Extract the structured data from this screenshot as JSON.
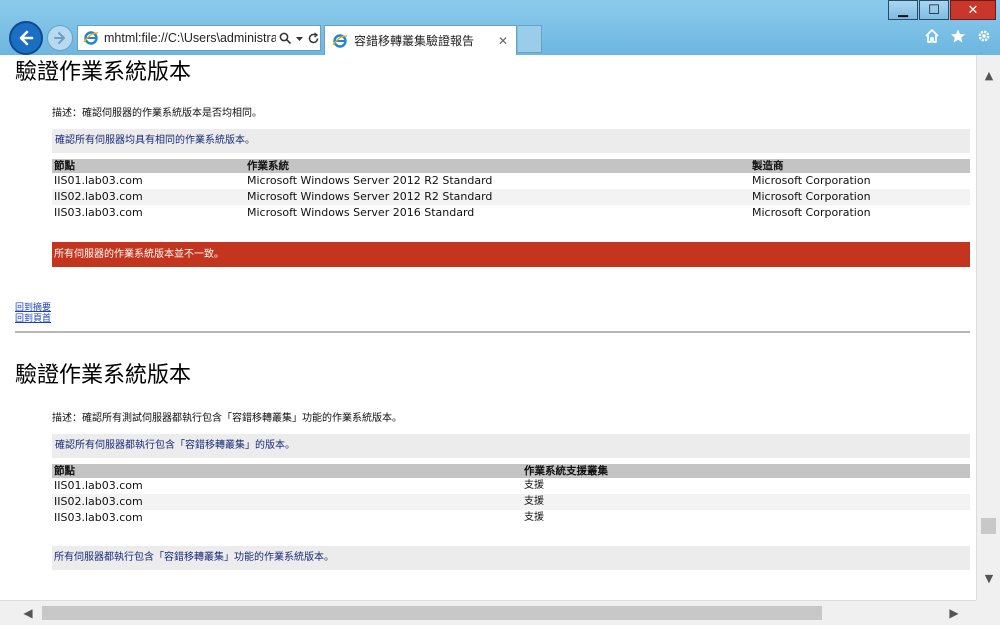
{
  "browser": {
    "address": "mhtml:file://C:\\Users\\administra",
    "tab_title": "容錯移轉叢集驗證報告",
    "tab_close": "✕",
    "window_controls": {
      "minimize": "▁",
      "maximize": "☐",
      "close": "✕"
    },
    "icons": [
      "back-arrow-icon",
      "forward-arrow-icon",
      "ie-logo-icon",
      "search-icon",
      "dropdown-icon",
      "refresh-icon",
      "home-icon",
      "favorites-star-icon",
      "settings-gear-icon"
    ]
  },
  "section1": {
    "title": "驗證作業系統版本",
    "description": "描述：確認伺服器的作業系統版本是否均相同。",
    "info": "確認所有伺服器均具有相同的作業系統版本。",
    "table": {
      "headers": [
        "節點",
        "作業系統",
        "製造商"
      ],
      "rows": [
        [
          "IIS01.lab03.com",
          "Microsoft Windows Server 2012 R2 Standard",
          "Microsoft Corporation"
        ],
        [
          "IIS02.lab03.com",
          "Microsoft Windows Server 2012 R2 Standard",
          "Microsoft Corporation"
        ],
        [
          "IIS03.lab03.com",
          "Microsoft Windows Server 2016 Standard",
          "Microsoft Corporation"
        ]
      ]
    },
    "error": "所有伺服器的作業系統版本並不一致。",
    "links": [
      "回到摘要",
      "回到頁首"
    ]
  },
  "section2": {
    "title": "驗證作業系統版本",
    "description": "描述：確認所有測試伺服器都執行包含「容錯移轉叢集」功能的作業系統版本。",
    "info": "確認所有伺服器都執行包含「容錯移轉叢集」的版本。",
    "table": {
      "headers": [
        "節點",
        "作業系統支援叢集"
      ],
      "rows": [
        [
          "IIS01.lab03.com",
          "支援"
        ],
        [
          "IIS02.lab03.com",
          "支援"
        ],
        [
          "IIS03.lab03.com",
          "支援"
        ]
      ]
    },
    "summary": "所有伺服器都執行包含「容錯移轉叢集」功能的作業系統版本。"
  },
  "colors": {
    "error": "#c4351f",
    "info_text": "#1a2a7a",
    "link": "#1a3fbf",
    "chrome": "#7ec0e4"
  }
}
